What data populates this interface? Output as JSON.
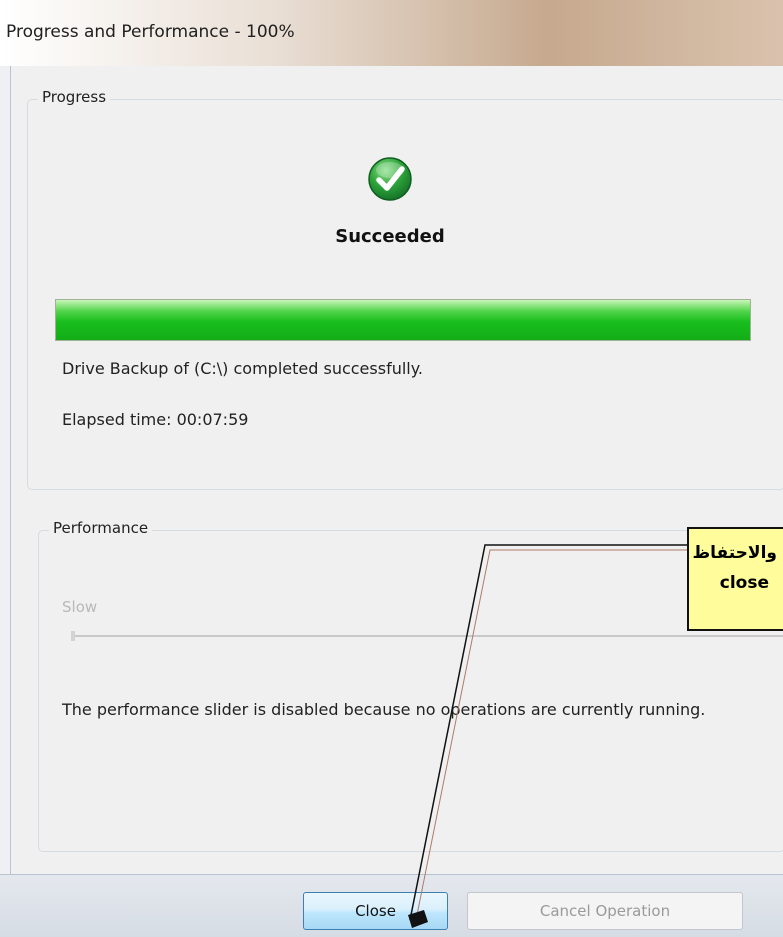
{
  "window": {
    "title": "Progress and Performance - 100%"
  },
  "progress": {
    "legend": "Progress",
    "status_icon": "success-check-icon",
    "status": "Succeeded",
    "percent": 100,
    "message": "Drive Backup of  (C:\\) completed successfully.",
    "elapsed": "Elapsed time:  00:07:59"
  },
  "performance": {
    "legend": "Performance",
    "slider_label": "Slow",
    "slider_level": 0,
    "message": "The performance slider is disabled because no operations are currently running."
  },
  "buttons": {
    "close": "Close",
    "cancel": "Cancel Operation"
  },
  "annotation": {
    "line1": "والاحتفاظ",
    "line2": "close"
  },
  "colors": {
    "progress_fill": "#18be1d",
    "close_border": "#3c7fb1",
    "callout_bg": "#fffd9b"
  }
}
